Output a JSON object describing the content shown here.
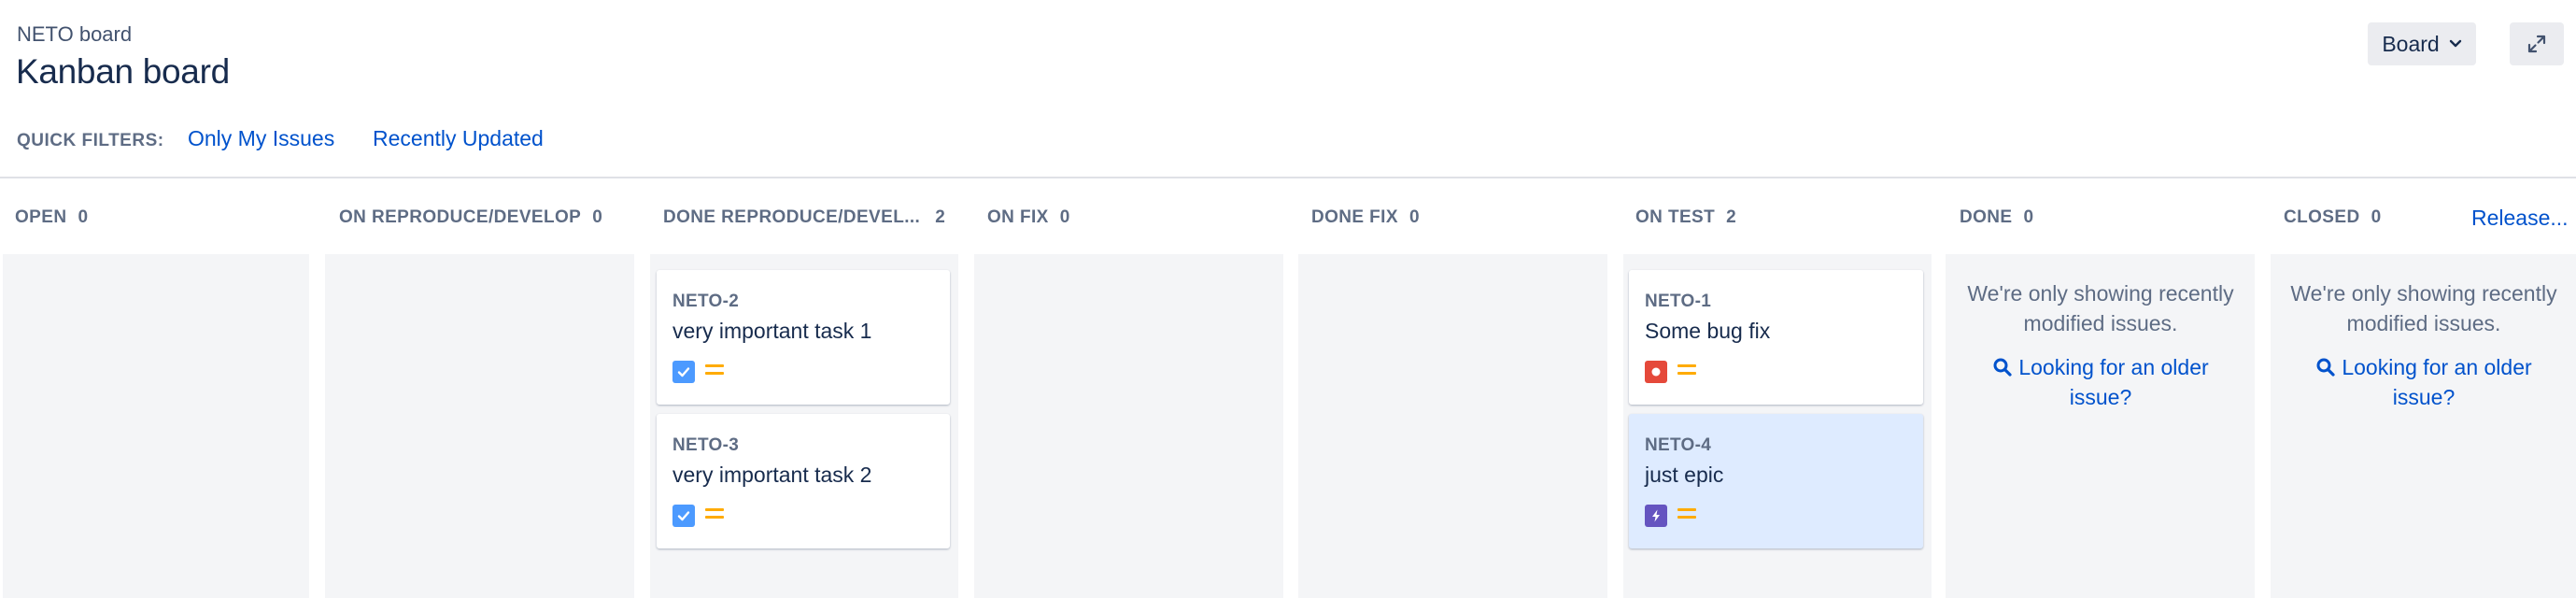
{
  "header": {
    "project_name": "NETO board",
    "board_title": "Kanban board",
    "board_button": "Board",
    "quick_filters_label": "QUICK FILTERS:",
    "quick_filters": [
      "Only My Issues",
      "Recently Updated"
    ]
  },
  "columns": [
    {
      "name": "OPEN",
      "count": "0"
    },
    {
      "name": "ON REPRODUCE/DEVELOP",
      "count": "0"
    },
    {
      "name": "DONE REPRODUCE/DEVEL...",
      "count": "2"
    },
    {
      "name": "ON FIX",
      "count": "0"
    },
    {
      "name": "DONE FIX",
      "count": "0"
    },
    {
      "name": "ON TEST",
      "count": "2"
    },
    {
      "name": "DONE",
      "count": "0"
    },
    {
      "name": "CLOSED",
      "count": "0"
    }
  ],
  "release_link": "Release...",
  "cards": [
    {
      "key": "NETO-2",
      "summary": "very important task 1",
      "type": "task",
      "priority": "medium"
    },
    {
      "key": "NETO-3",
      "summary": "very important task 2",
      "type": "task",
      "priority": "medium"
    },
    {
      "key": "NETO-1",
      "summary": "Some bug fix",
      "type": "bug",
      "priority": "medium"
    },
    {
      "key": "NETO-4",
      "summary": "just epic",
      "type": "epic",
      "priority": "medium",
      "selected": true
    }
  ],
  "done_column": {
    "message": "We're only showing recently modified issues.",
    "link": "Looking for an older issue?"
  },
  "closed_column": {
    "message": "We're only showing recently modified issues.",
    "link": "Looking for an older issue?"
  },
  "colors": {
    "link": "#0052cc",
    "task_icon": "#4c9aff",
    "bug_icon": "#e5493a",
    "epic_icon": "#6554c0",
    "priority_medium": "#ffab00",
    "selected_card": "#deebff"
  },
  "icons": {
    "board_chevron": "chevron-down-icon",
    "expand": "expand-icon",
    "search": "search-icon"
  }
}
